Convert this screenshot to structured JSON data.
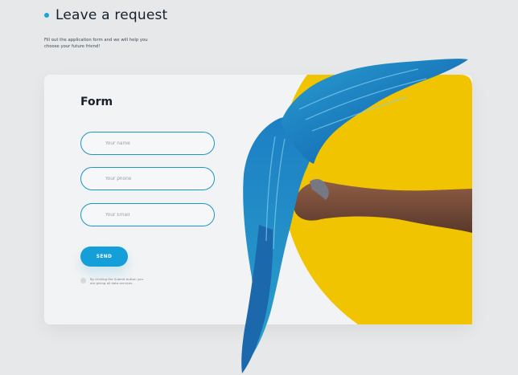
{
  "header": {
    "title": "Leave a request",
    "subtitle": "Fill out the application form and we will help you choose your future friend!"
  },
  "form": {
    "title": "Form",
    "fields": [
      {
        "placeholder": "Your name",
        "value": ""
      },
      {
        "placeholder": "Your phone",
        "value": ""
      },
      {
        "placeholder": "Your Email",
        "value": ""
      }
    ],
    "send_label": "SEND",
    "consent_text": "By clicking the Submit button you are giving all data services"
  },
  "colors": {
    "accent": "#149fd8",
    "yellow": "#f0c400",
    "background": "#e7e8ea"
  },
  "illustration": {
    "subject": "blue-and-yellow macaw perched on an arm"
  }
}
